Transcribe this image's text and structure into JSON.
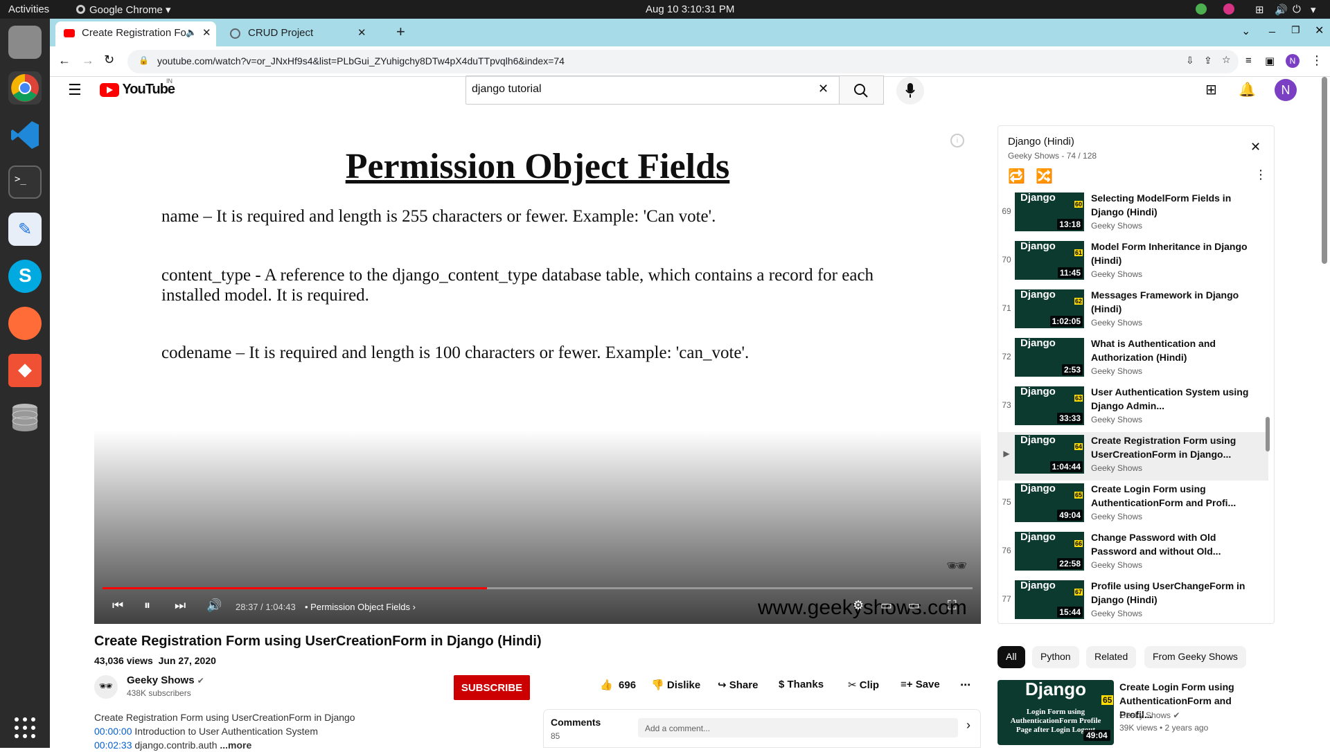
{
  "os": {
    "activities": "Activities",
    "app_menu": "Google Chrome",
    "clock": "Aug 10  3:10:31 PM"
  },
  "browser": {
    "tabs": [
      {
        "label": "Create Registration Fo",
        "active": true
      },
      {
        "label": "CRUD Project",
        "active": false
      }
    ],
    "url": "youtube.com/watch?v=or_JNxHf9s4&list=PLbGui_ZYuhigchy8DTw4pX4duTTpvqlh6&index=74"
  },
  "youtube": {
    "logo": "YouTube",
    "region": "IN",
    "search_value": "django tutorial",
    "avatar_letter": "N"
  },
  "slide": {
    "title": "Permission Object Fields",
    "lines": [
      "name – It is required and length is 255 characters or fewer. Example: 'Can vote'.",
      "content_type - A reference to the django_content_type database table, which contains a record for each installed model. It is required.",
      "codename – It is required and length is 100 characters or fewer. Example: 'can_vote'."
    ],
    "watermark": "www.geekyshows.com"
  },
  "player": {
    "time": "28:37 / 1:04:43",
    "chapter": "Permission Object Fields",
    "progress_fraction": 0.442
  },
  "video": {
    "title": "Create Registration Form using UserCreationForm in Django (Hindi)",
    "views": "43,036 views",
    "date": "Jun 27, 2020",
    "channel": "Geeky Shows",
    "subscribers": "438K subscribers",
    "subscribe": "SUBSCRIBE",
    "likes": "696",
    "dislike": "Dislike",
    "share": "Share",
    "thanks": "Thanks",
    "clip": "Clip",
    "save": "Save",
    "description_line": "Create Registration Form using UserCreationForm in Django",
    "chapters": [
      {
        "time": "00:00:00",
        "text": "Introduction to User Authentication System"
      },
      {
        "time": "00:02:33",
        "text": "django.contrib.auth"
      }
    ],
    "more": "...more",
    "comments_label": "Comments",
    "comments_count": "85",
    "comment_placeholder": "Add a comment..."
  },
  "playlist": {
    "title": "Django (Hindi)",
    "meta": "Geeky Shows - 74 / 128",
    "items": [
      {
        "idx": "69",
        "title": "Selecting ModelForm Fields in Django (Hindi)",
        "channel": "Geeky Shows",
        "duration": "13:18",
        "num": "60",
        "current": false
      },
      {
        "idx": "70",
        "title": "Model Form Inheritance in Django (Hindi)",
        "channel": "Geeky Shows",
        "duration": "11:45",
        "num": "61",
        "current": false
      },
      {
        "idx": "71",
        "title": "Messages Framework in Django (Hindi)",
        "channel": "Geeky Shows",
        "duration": "1:02:05",
        "num": "62",
        "current": false
      },
      {
        "idx": "72",
        "title": "What is Authentication and Authorization (Hindi)",
        "channel": "Geeky Shows",
        "duration": "2:53",
        "num": "",
        "current": false
      },
      {
        "idx": "73",
        "title": "User Authentication System using Django Admin...",
        "channel": "Geeky Shows",
        "duration": "33:33",
        "num": "63",
        "current": false
      },
      {
        "idx": "▶",
        "title": "Create Registration Form using UserCreationForm in Django...",
        "channel": "Geeky Shows",
        "duration": "1:04:44",
        "num": "64",
        "current": true
      },
      {
        "idx": "75",
        "title": "Create Login Form using AuthenticationForm and Profi...",
        "channel": "Geeky Shows",
        "duration": "49:04",
        "num": "65",
        "current": false
      },
      {
        "idx": "76",
        "title": "Change Password with Old Password and without Old...",
        "channel": "Geeky Shows",
        "duration": "22:58",
        "num": "66",
        "current": false
      },
      {
        "idx": "77",
        "title": "Profile using UserChangeForm in Django (Hindi)",
        "channel": "Geeky Shows",
        "duration": "15:44",
        "num": "67",
        "current": false
      }
    ]
  },
  "chips": [
    "All",
    "Python",
    "Related",
    "From Geeky Shows"
  ],
  "recommendation": {
    "title": "Create Login Form using AuthenticationForm and Profil...",
    "channel": "Geeky Shows",
    "meta": "39K views • 2 years ago",
    "duration": "49:04",
    "num": "65",
    "thumb_text": "Login Form using AuthenticationForm Profile Page after Login Logout"
  }
}
